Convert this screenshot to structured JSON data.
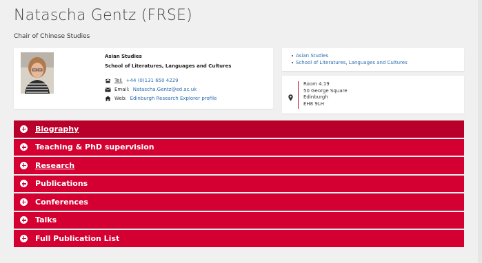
{
  "profile": {
    "name": "Natascha Gentz (FRSE)",
    "title": "Chair of Chinese Studies",
    "org_primary": "Asian Studies",
    "org_secondary": "School of Literatures, Languages and Cultures"
  },
  "contact": {
    "tel_label": "Tel:",
    "tel_value": "+44 (0)131 650 4229",
    "email_label": "Email:",
    "email_value": "Natascha.Gentz@ed.ac.uk",
    "web_label": "Web:",
    "web_value": "Edinburgh Research Explorer profile",
    "icons": [
      "phone-icon",
      "email-icon",
      "home-icon"
    ]
  },
  "links": [
    "Asian Studies",
    "School of Literatures, Languages and Cultures"
  ],
  "address": {
    "icon": "map-pin-icon",
    "lines": [
      "Room 4.19",
      "50 George Square",
      "Edinburgh",
      "EH8 9LH"
    ]
  },
  "accordion": [
    {
      "label": "Biography",
      "underlined": true
    },
    {
      "label": "Teaching & PhD supervision",
      "underlined": false
    },
    {
      "label": "Research",
      "underlined": true
    },
    {
      "label": "Publications",
      "underlined": false
    },
    {
      "label": "Conferences",
      "underlined": false
    },
    {
      "label": "Talks",
      "underlined": false
    },
    {
      "label": "Full Publication List",
      "underlined": false
    }
  ],
  "colors": {
    "accent": "#d50032",
    "accent_dark": "#b9002a",
    "link": "#2b6cb0",
    "background": "#f0f0f0"
  }
}
